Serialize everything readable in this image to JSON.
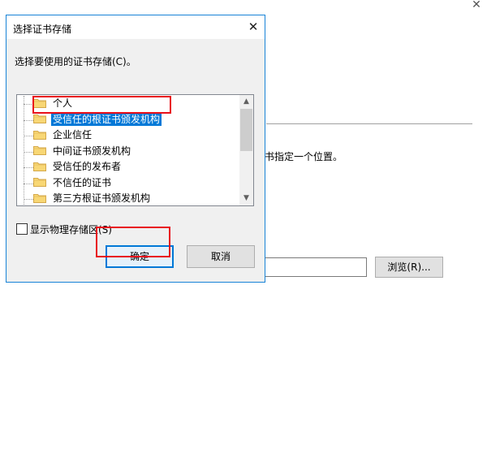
{
  "background_window": {
    "close_glyph": "✕",
    "instruction_text": "书指定一个位置。",
    "path_value": "",
    "browse_label": "浏览(R)..."
  },
  "dialog": {
    "title": "选择证书存储",
    "close_glyph": "✕",
    "prompt": "选择要使用的证书存储(C)。",
    "tree_items": [
      {
        "label": "个人"
      },
      {
        "label": "受信任的根证书颁发机构"
      },
      {
        "label": "企业信任"
      },
      {
        "label": "中间证书颁发机构"
      },
      {
        "label": "受信任的发布者"
      },
      {
        "label": "不信任的证书"
      },
      {
        "label": "第三方根证书颁发机构"
      }
    ],
    "selected_index": 1,
    "show_physical_label": "显示物理存储区(S)",
    "show_physical_checked": false,
    "ok_label": "确定",
    "cancel_label": "取消",
    "icons": {
      "folder": "folder-icon",
      "scroll_up": "scroll-up-arrow-icon",
      "scroll_down": "scroll-down-arrow-icon"
    }
  },
  "colors": {
    "accent": "#0078d7",
    "highlight_annotation": "#e8101b",
    "dialog_border": "#1883d7"
  }
}
